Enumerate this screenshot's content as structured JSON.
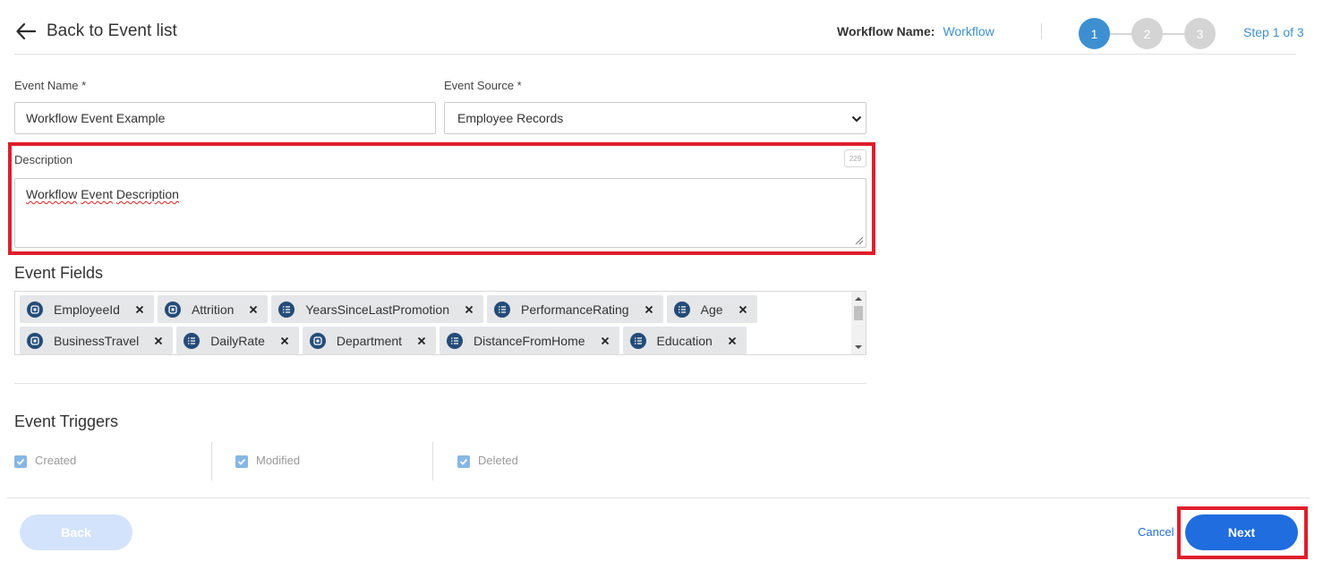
{
  "header": {
    "back_label": "Back to Event list",
    "workflow_name_label": "Workflow Name:",
    "workflow_name_value": "Workflow",
    "steps": [
      "1",
      "2",
      "3"
    ],
    "current_step": 1,
    "step_indicator": "Step 1 of 3"
  },
  "form": {
    "event_name_label": "Event Name *",
    "event_name_value": "Workflow Event Example",
    "event_source_label": "Event Source *",
    "event_source_value": "Employee Records",
    "description_label": "Description",
    "description_char_count": "229",
    "description_words": [
      "Workflow",
      "Event",
      "Description"
    ]
  },
  "event_fields": {
    "title": "Event Fields",
    "rows": [
      [
        {
          "label": "EmployeeId",
          "icon": "id-field-icon"
        },
        {
          "label": "Attrition",
          "icon": "id-field-icon"
        },
        {
          "label": "YearsSinceLastPromotion",
          "icon": "numeric-field-icon"
        },
        {
          "label": "PerformanceRating",
          "icon": "numeric-field-icon"
        },
        {
          "label": "Age",
          "icon": "numeric-field-icon"
        }
      ],
      [
        {
          "label": "BusinessTravel",
          "icon": "id-field-icon"
        },
        {
          "label": "DailyRate",
          "icon": "numeric-field-icon"
        },
        {
          "label": "Department",
          "icon": "id-field-icon"
        },
        {
          "label": "DistanceFromHome",
          "icon": "numeric-field-icon"
        },
        {
          "label": "Education",
          "icon": "numeric-field-icon"
        }
      ]
    ]
  },
  "event_triggers": {
    "title": "Event Triggers",
    "items": [
      {
        "label": "Created",
        "checked": true
      },
      {
        "label": "Modified",
        "checked": true
      },
      {
        "label": "Deleted",
        "checked": true
      }
    ]
  },
  "footer": {
    "back_label": "Back",
    "cancel_label": "Cancel",
    "next_label": "Next"
  },
  "colors": {
    "accent": "#3d8fd1",
    "primary_button": "#1f6dde",
    "disabled_button": "#d3e3fb",
    "highlight": "#e01e2b",
    "tag_icon": "#244c79"
  }
}
